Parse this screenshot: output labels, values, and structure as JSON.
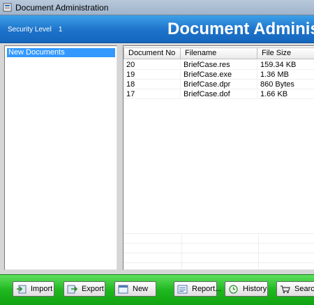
{
  "window": {
    "title": "Document Administration"
  },
  "banner": {
    "security_label": "Security Level",
    "security_value": "1",
    "title": "Document Administration"
  },
  "tree": {
    "items": [
      {
        "label": "New Documents",
        "selected": true
      }
    ]
  },
  "documents": {
    "columns": [
      "Document No",
      "Filename",
      "File Size"
    ],
    "rows": [
      [
        "20",
        "BriefCase.res",
        "159.34 KB"
      ],
      [
        "19",
        "BriefCase.exe",
        "1.36 MB"
      ],
      [
        "18",
        "BriefCase.dpr",
        "860 Bytes"
      ],
      [
        "17",
        "BriefCase.dof",
        "1.66 KB"
      ]
    ]
  },
  "toolbar": {
    "import_label": "Import",
    "export_label": "Export",
    "new_label": "New",
    "report_label": "Report...",
    "history_label": "History",
    "search_label": "Search"
  },
  "colors": {
    "banner": "#1d72c9",
    "toolbar": "#1fb81f",
    "selection": "#3399ff"
  }
}
